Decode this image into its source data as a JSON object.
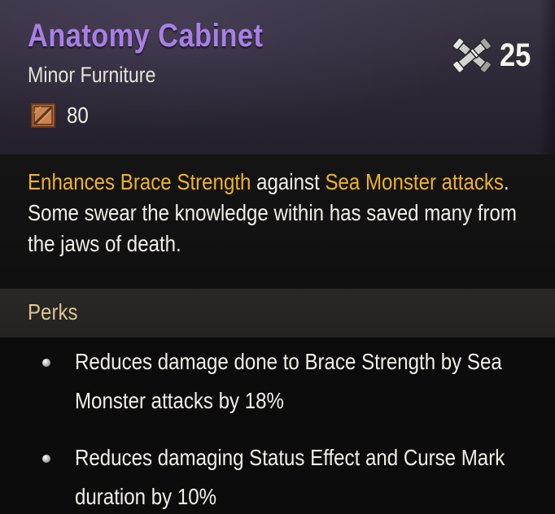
{
  "item": {
    "name": "Anatomy Cabinet",
    "type": "Minor Furniture",
    "stat_icon": "crate-icon",
    "stat_value": "80",
    "gear_score_icon": "crossed-cannons-icon",
    "gear_score": "25",
    "name_color": "#a87fe6",
    "highlight_color": "#f0b323"
  },
  "description": {
    "part1_highlight": "Enhances Brace Strength",
    "part2": " against ",
    "part3_highlight": "Sea Monster attacks",
    "part4": ".",
    "line2": "Some swear the knowledge within has saved many from",
    "line3": "the jaws of death."
  },
  "perks": {
    "title": "Perks",
    "items": [
      {
        "line1": "Reduces damage done to Brace Strength by Sea",
        "line2": "Monster attacks by 18%"
      },
      {
        "line1": "Reduces damaging Status Effect and Curse Mark",
        "line2": "duration by 10%"
      }
    ]
  }
}
